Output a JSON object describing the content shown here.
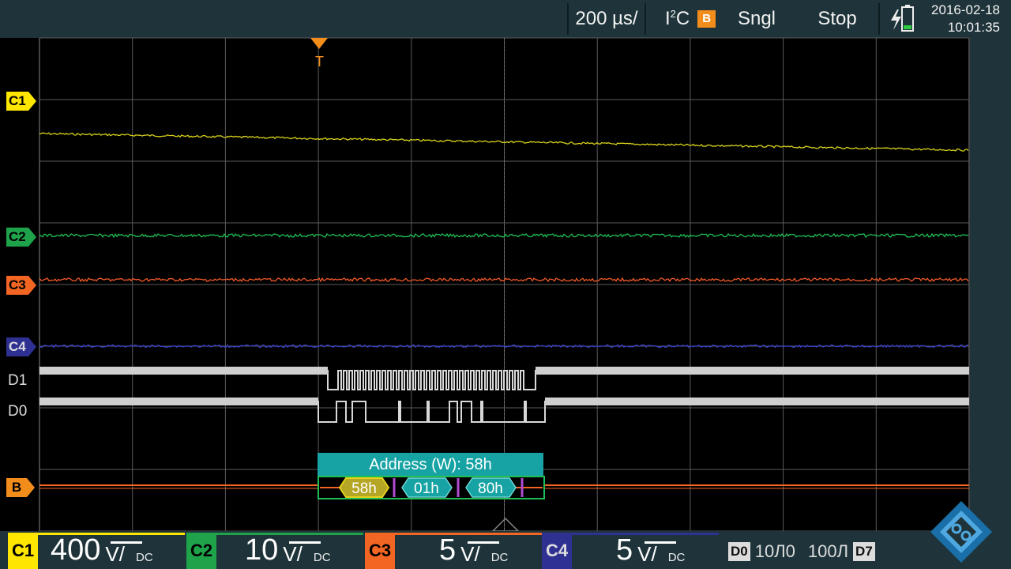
{
  "topbar": {
    "timebase": "200 µs/",
    "protocol_prefix": "I",
    "protocol_sup": "2",
    "protocol_suffix": "C",
    "bus_tag": "B",
    "trigger_mode": "Sngl",
    "acq_state": "Stop",
    "date": "2016-02-18",
    "time": "10:01:35"
  },
  "trigger": {
    "label": "T"
  },
  "markers": {
    "c1": "C1",
    "c2": "C2",
    "c3": "C3",
    "c4": "C4",
    "bus": "B",
    "d1": "D1",
    "d0": "D0"
  },
  "decode": {
    "header": "Address (W): 58h",
    "frames": [
      "58h",
      "01h",
      "80h"
    ]
  },
  "channels": [
    {
      "id": "C1",
      "value": "400",
      "unit": "V/",
      "coupling": "DC",
      "color": "#ffe600"
    },
    {
      "id": "C2",
      "value": "10",
      "unit": "V/",
      "coupling": "DC",
      "color": "#1fa34a"
    },
    {
      "id": "C3",
      "value": "5",
      "unit": "V/",
      "coupling": "DC",
      "color": "#f26522"
    },
    {
      "id": "C4",
      "value": "5",
      "unit": "V/",
      "coupling": "DC",
      "color": "#2e3192"
    }
  ],
  "digital": {
    "start": "D0",
    "thr1": "10Л0",
    "thr2": "100Л",
    "end": "D7"
  },
  "colors": {
    "c1": "#d8d21a",
    "c2": "#1fbf55",
    "c3": "#f05a28",
    "c4": "#3a40c8",
    "bus": "#f26522",
    "grid": "#5a5a5a",
    "accent": "#f28c1a",
    "teal": "#17a3a4"
  }
}
